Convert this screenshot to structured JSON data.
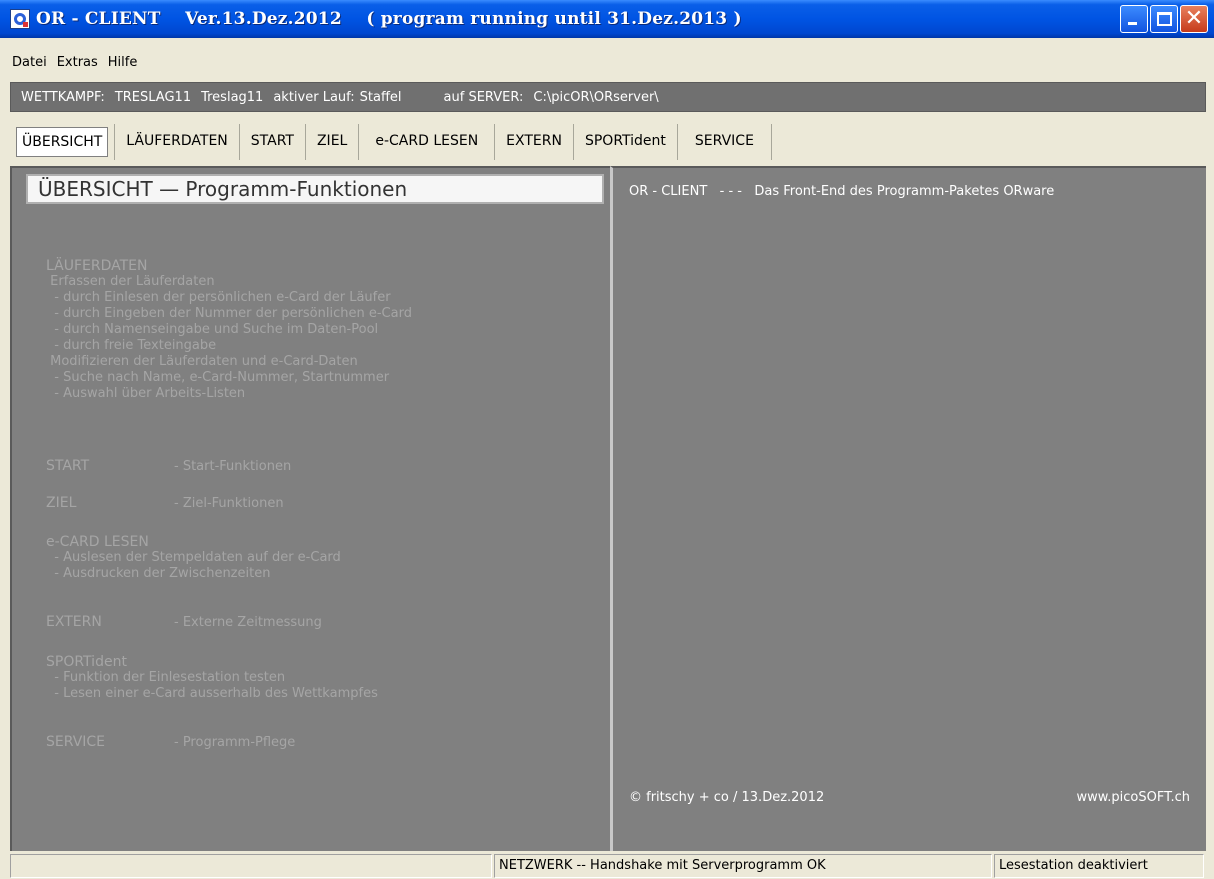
{
  "window": {
    "title": "OR - CLIENT    Ver.13.Dez.2012    ( program running until 31.Dez.2013 )",
    "app_icon": "or-client-app-icon",
    "controls": {
      "minimize": "minimize-icon",
      "maximize": "maximize-icon",
      "close": "close-icon"
    }
  },
  "menu": {
    "items": [
      "Datei",
      "Extras",
      "Hilfe"
    ]
  },
  "infobar": {
    "wettkampf_label": "WETTKAMPF:",
    "wettkampf_code": "TRESLAG11",
    "wettkampf_name": "Treslag11",
    "lauf_label": "aktiver Lauf:",
    "lauf_value": "Staffel",
    "server_label": "auf SERVER:",
    "server_path": "C:\\picOR\\ORserver\\"
  },
  "tabs": [
    {
      "label": "ÜBERSICHT",
      "active": true
    },
    {
      "label": "LÄUFERDATEN",
      "active": false
    },
    {
      "label": "START",
      "active": false
    },
    {
      "label": "ZIEL",
      "active": false
    },
    {
      "label": "e-CARD LESEN",
      "active": false
    },
    {
      "label": "EXTERN",
      "active": false
    },
    {
      "label": "SPORTident",
      "active": false
    },
    {
      "label": "SERVICE",
      "active": false
    }
  ],
  "left_panel": {
    "heading": "ÜBERSICHT  —  Programm-Funktionen",
    "laeuferdaten": {
      "heading": "LÄUFERDATEN",
      "lines": [
        " Erfassen der Läuferdaten",
        "  - durch Einlesen der persönlichen e-Card der Läufer",
        "  - durch Eingeben der Nummer der persönlichen e-Card",
        "  - durch Namenseingabe und Suche im Daten-Pool",
        "  - durch freie Texteingabe",
        " Modifizieren der Läuferdaten und e-Card-Daten",
        "  - Suche nach Name, e-Card-Nummer, Startnummer",
        "  - Auswahl über Arbeits-Listen"
      ]
    },
    "start": {
      "heading": "START",
      "desc": "- Start-Funktionen"
    },
    "ziel": {
      "heading": "ZIEL",
      "desc": "- Ziel-Funktionen"
    },
    "ecard": {
      "heading": "e-CARD LESEN",
      "lines": [
        "  - Auslesen der Stempeldaten auf der e-Card",
        "  - Ausdrucken der Zwischenzeiten"
      ]
    },
    "extern": {
      "heading": "EXTERN",
      "desc": "- Externe Zeitmessung"
    },
    "sportident": {
      "heading": "SPORTident",
      "lines": [
        "  - Funktion der Einlesestation testen",
        "  - Lesen einer e-Card ausserhalb des Wettkampfes"
      ]
    },
    "service": {
      "heading": "SERVICE",
      "desc": "- Programm-Pflege"
    }
  },
  "right_panel": {
    "description": "OR - CLIENT   - - -   Das Front-End des Programm-Paketes ORware",
    "copyright": "© fritschy + co / 13.Dez.2012",
    "website": "www.picoSOFT.ch"
  },
  "statusbar": {
    "left": "",
    "network": "NETZWERK -- Handshake mit Serverprogramm OK",
    "reader": "Lesestation deaktiviert"
  }
}
